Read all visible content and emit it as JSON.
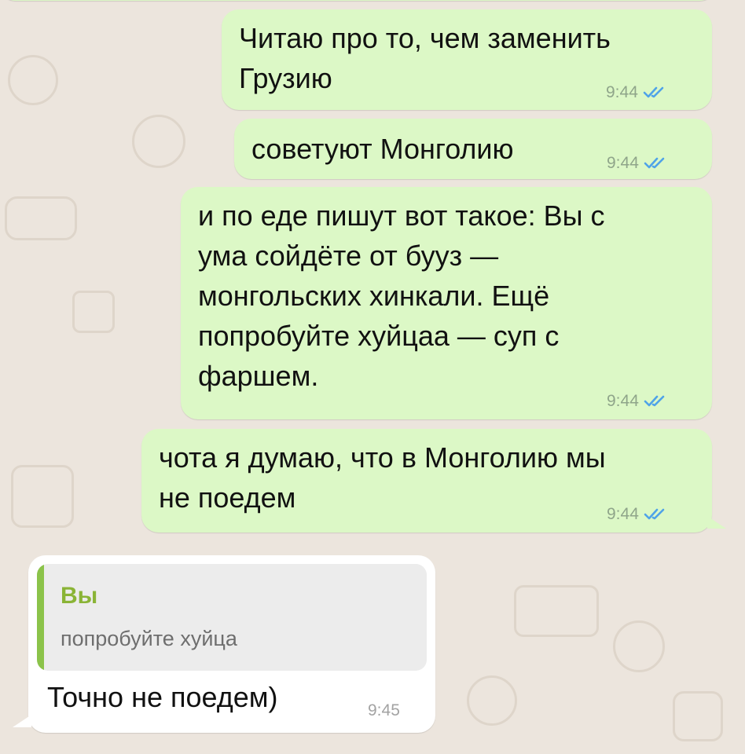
{
  "messages": [
    {
      "direction": "outgoing",
      "text": "Читаю про то, чем заменить\nГрузию",
      "time": "9:44",
      "status": "read"
    },
    {
      "direction": "outgoing",
      "text": "советуют Монголию",
      "time": "9:44",
      "status": "read"
    },
    {
      "direction": "outgoing",
      "text": "и по еде пишут вот такое: Вы с\nума сойдёте от бууз —\nмонгольских хинкали. Ещё\nпопробуйте хуйцаа — суп с\nфаршем.",
      "time": "9:44",
      "status": "read"
    },
    {
      "direction": "outgoing",
      "text": "чота я думаю, что в Монголию мы\nне поедем",
      "time": "9:44",
      "status": "read"
    },
    {
      "direction": "incoming",
      "reply": {
        "author": "Вы",
        "text": "попробуйте хуйца"
      },
      "text": "Точно не поедем)",
      "time": "9:45"
    }
  ],
  "colors": {
    "background": "#ece5dd",
    "outgoing_bubble": "#dcf8c6",
    "incoming_bubble": "#ffffff",
    "read_ticks": "#4fa3e8",
    "quote_accent": "#8bc34a",
    "quote_author": "#8ab436"
  },
  "icons": {
    "read_receipt": "double-check-icon"
  }
}
